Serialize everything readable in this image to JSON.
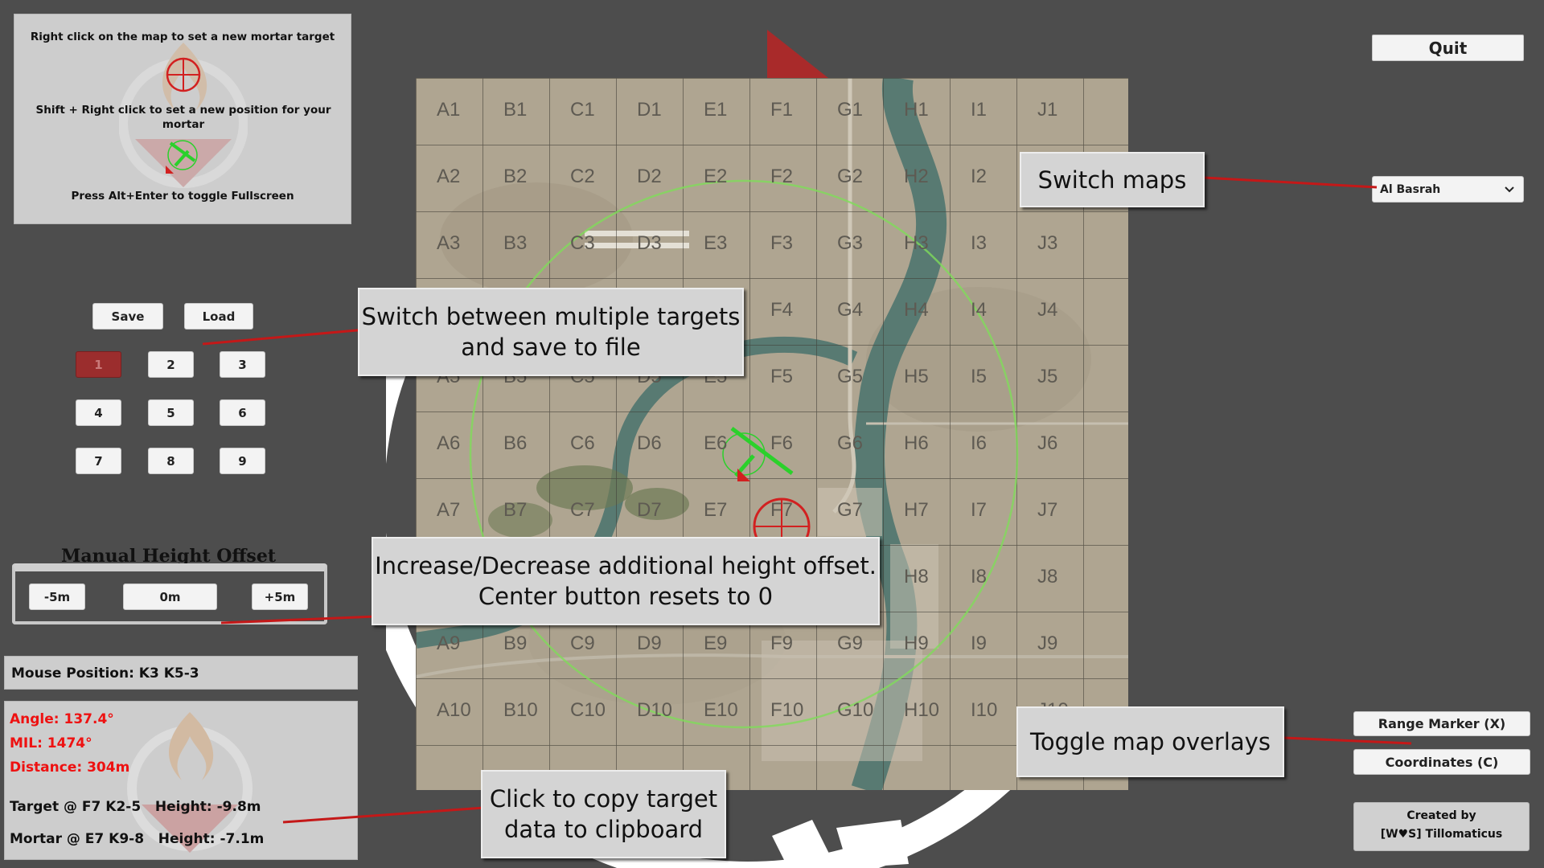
{
  "help": {
    "line1": "Right click on the map to set a new mortar target",
    "line2": "Shift + Right click to set a new position for your mortar",
    "line3": "Press Alt+Enter to toggle Fullscreen"
  },
  "quit_label": "Quit",
  "map_select": {
    "value": "Al Basrah"
  },
  "saveload": {
    "save_label": "Save",
    "load_label": "Load"
  },
  "target_slots": [
    "1",
    "2",
    "3",
    "4",
    "5",
    "6",
    "7",
    "8",
    "9"
  ],
  "selected_slot": "1",
  "height_offset": {
    "title": "Manual Height Offset",
    "minus_label": "-5m",
    "center_label": "0m",
    "plus_label": "+5m"
  },
  "mouse_position": "Mouse Position: K3 K5-3",
  "results": {
    "angle": "Angle: 137.4°",
    "mil": "MIL: 1474°",
    "distance": "Distance: 304m",
    "target": "Target @ F7 K2-5   Height: -9.8m",
    "mortar": "Mortar @ E7 K9-8   Height: -7.1m"
  },
  "overlays": {
    "range_marker": "Range Marker (X)",
    "coordinates": "Coordinates (C)"
  },
  "credits": {
    "line1": "Created by",
    "line2": "[W♥S] Tillomaticus"
  },
  "callouts": {
    "switch_maps": "Switch maps",
    "switch_targets_1": "Switch between multiple targets",
    "switch_targets_2": "and save to file",
    "height_1": "Increase/Decrease additional height offset.",
    "height_2": "Center button resets to 0",
    "toggle_overlays": "Toggle map overlays",
    "copy_1": "Click to copy target",
    "copy_2": "data to clipboard"
  },
  "grid": {
    "cols": [
      "A",
      "B",
      "C",
      "D",
      "E",
      "F",
      "G",
      "H",
      "I",
      "J"
    ],
    "rows": [
      "1",
      "2",
      "3",
      "4",
      "5",
      "6",
      "7",
      "8",
      "9",
      "10"
    ]
  },
  "colors": {
    "background": "#4d4d4d",
    "selected_slot": "#9b2d2d",
    "error_text": "#e11111",
    "range_circle": "#7fdc5a",
    "mortar_marker": "#2bd12b",
    "target_marker": "#d22020",
    "callout_line": "#c41818"
  }
}
